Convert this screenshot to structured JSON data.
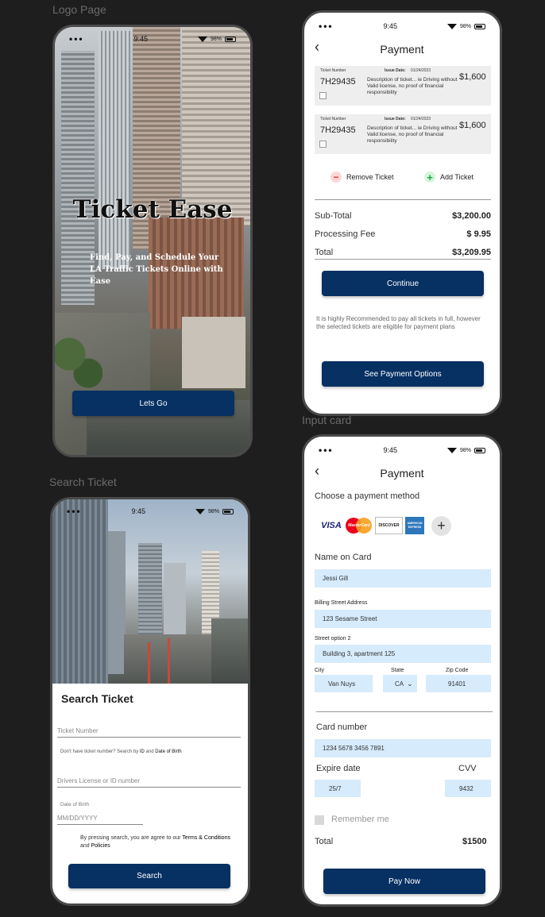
{
  "labels": {
    "logo_page": "Logo Page",
    "search_ticket": "Search Ticket",
    "input_card": "Input card"
  },
  "status": {
    "time": "9:45",
    "battery": "98%"
  },
  "logo_page": {
    "title": "Ticket Ease",
    "subtitle": "Find, Pay, and Schedule Your LA Traffic Tickets Online with Ease",
    "button": "Lets Go"
  },
  "search": {
    "title": "Search Ticket",
    "ticket_number_placeholder": "Ticket Number",
    "hint_prefix": "Don't have ticket number? Search by ",
    "hint_id": "ID",
    "hint_and": " and ",
    "hint_dob": "Date of Birth",
    "license_placeholder": "Drivers License or ID number",
    "dob_label": "Date of Birth",
    "dob_placeholder": "MM/DD/YYYY",
    "terms_prefix": "By pressing search, you are agree to our ",
    "terms_link": "Terms & Conditions",
    "terms_and": " and ",
    "policies_link": "Policies",
    "button": "Search"
  },
  "payment": {
    "title": "Payment",
    "tickets": [
      {
        "number_label": "Ticket Number",
        "number": "7H29435",
        "issue_label": "Issue Date:",
        "issue_date": "01/24/2023",
        "description": "Description of ticket... ie Driving without Valid license, no proof of financial responsibility",
        "amount": "$1,600"
      },
      {
        "number_label": "Ticket Number",
        "number": "7H29435",
        "issue_label": "Issue Date:",
        "issue_date": "01/24/2023",
        "description": "Description of ticket... ie Driving without Valid license, no proof of financial responsibility",
        "amount": "$1,600"
      }
    ],
    "remove_label": "Remove Ticket",
    "add_label": "Add Ticket",
    "subtotal_label": "Sub-Total",
    "subtotal": "$3,200.00",
    "fee_label": "Processing Fee",
    "fee": "$ 9.95",
    "total_label": "Total",
    "total": "$3,209.95",
    "continue_button": "Continue",
    "note": "It is highly Recommended to pay all tickets in full, however the selected tickets are eligible for payment plans",
    "options_button": "See Payment Options"
  },
  "card": {
    "title": "Payment",
    "choose_method": "Choose a payment method",
    "logos": [
      "VISA",
      "MasterCard",
      "DISCOVER",
      "AMERICAN EXPRESS"
    ],
    "name_label": "Name on Card",
    "name_value": "Jessi Gill",
    "billing_label": "Billing Street Address",
    "billing_value": "123 Sesame Street",
    "street2_label": "Street option 2",
    "street2_value": "Building 3, apartment 125",
    "city_label": "City",
    "city_value": "Van Nuys",
    "state_label": "State",
    "state_value": "CA",
    "zip_label": "Zip Code",
    "zip_value": "91401",
    "card_number_label": "Card number",
    "card_number_value": "1234   5678   3456   7891",
    "expire_label": "Expire date",
    "expire_value": "25/7",
    "cvv_label": "CVV",
    "cvv_value": "9432",
    "remember_label": "Remember me",
    "total_label": "Total",
    "total_value": "$1500",
    "pay_button": "Pay Now"
  }
}
